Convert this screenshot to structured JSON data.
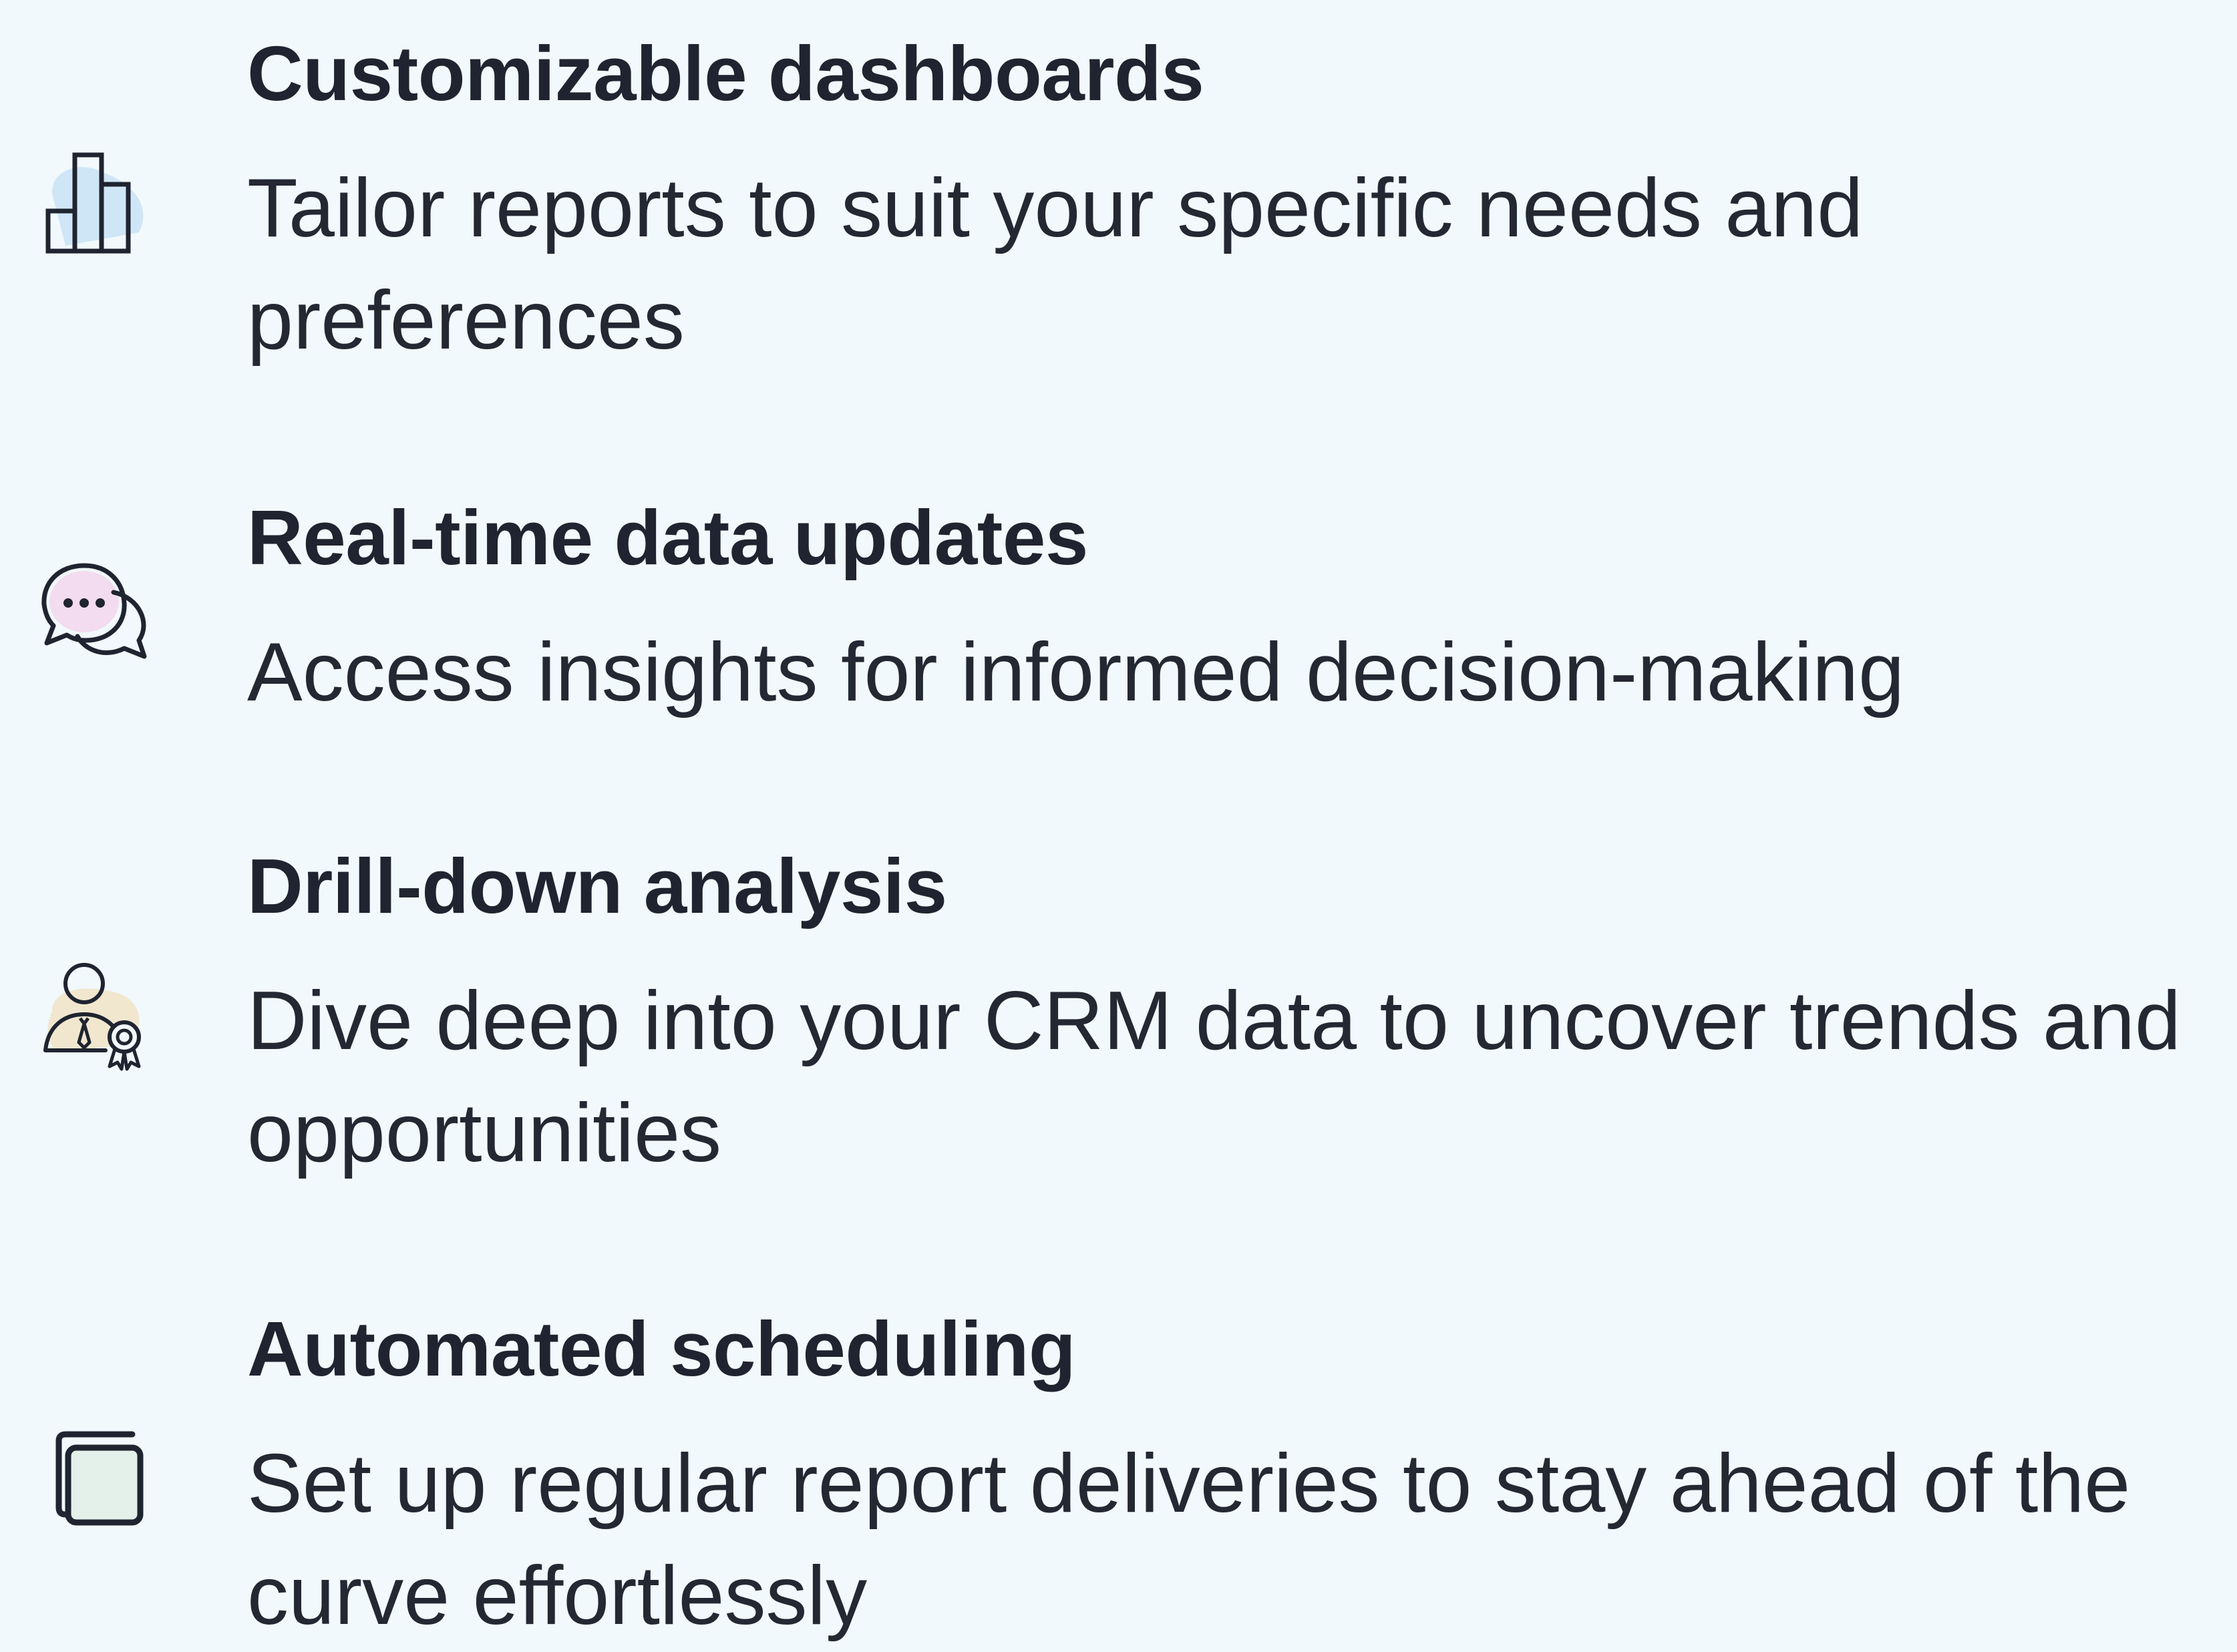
{
  "features": [
    {
      "title": "Customizable dashboards",
      "description": "Tailor reports to suit your specific needs and preferences",
      "icon": "bar-chart-icon"
    },
    {
      "title": "Real-time data updates",
      "description": "Access insights for informed decision-making",
      "icon": "chat-bubbles-icon"
    },
    {
      "title": "Drill-down analysis",
      "description": "Dive deep into your CRM data to uncover trends and opportunities",
      "icon": "user-award-icon"
    },
    {
      "title": "Automated scheduling",
      "description": "Set up regular report deliveries to stay ahead of the curve effortlessly",
      "icon": "copy-windows-icon"
    }
  ],
  "colors": {
    "background": "#f1f9fc",
    "text": "#1f2430",
    "icon_stroke": "#1f2430",
    "accent_blue": "#cfe6f6",
    "accent_pink": "#f3dcef",
    "accent_sand": "#f1e7cf",
    "accent_green": "#e3f1ea"
  }
}
